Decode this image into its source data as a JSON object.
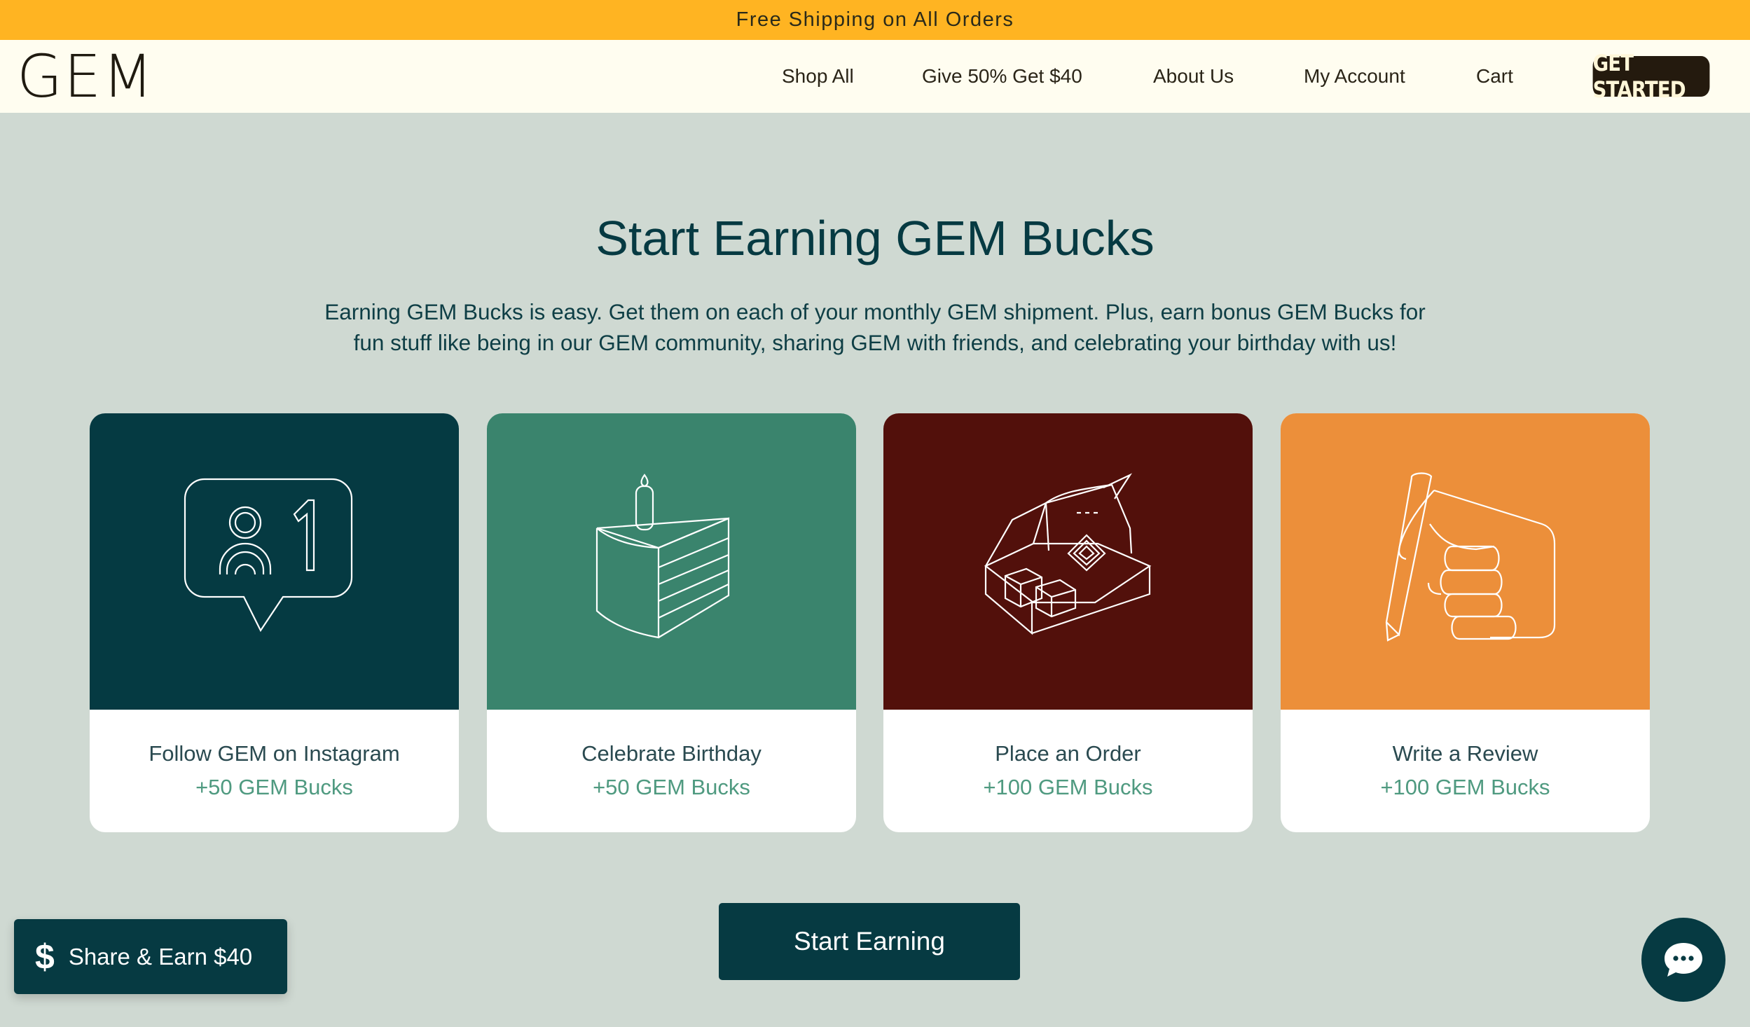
{
  "announcement": "Free Shipping on All Orders",
  "brand": {
    "logo": "GEM"
  },
  "nav": {
    "items": [
      "Shop All",
      "Give 50% Get $40",
      "About Us",
      "My Account",
      "Cart"
    ],
    "cta": "GET STARTED"
  },
  "hero": {
    "title": "Start Earning GEM Bucks",
    "intro_line1": "Earning GEM Bucks is easy. Get them on each of your monthly GEM shipment. Plus, earn bonus GEM Bucks for",
    "intro_line2": "fun stuff like being in our GEM community, sharing GEM with friends, and celebrating your birthday with us!"
  },
  "cards": [
    {
      "title": "Follow GEM on Instagram",
      "reward": "+50 GEM Bucks",
      "icon": "instagram-follow-icon",
      "color": "#053a42"
    },
    {
      "title": "Celebrate Birthday",
      "reward": "+50 GEM Bucks",
      "icon": "birthday-cake-icon",
      "color": "#3a846d"
    },
    {
      "title": "Place an Order",
      "reward": "+100 GEM Bucks",
      "icon": "open-box-icon",
      "color": "#52100b"
    },
    {
      "title": "Write a Review",
      "reward": "+100 GEM Bucks",
      "icon": "hand-pencil-icon",
      "color": "#ec8f3a"
    }
  ],
  "start_button": "Start Earning",
  "share_widget": {
    "icon": "dollar-icon",
    "label": "Share & Earn $40"
  },
  "chat_widget": {
    "icon": "chat-bubble-icon"
  },
  "colors": {
    "announce_bar": "#ffb422",
    "header_bg": "#fffdf0",
    "page_bg": "#cfd9d2",
    "primary": "#063a42",
    "reward_text": "#4f9a80"
  }
}
